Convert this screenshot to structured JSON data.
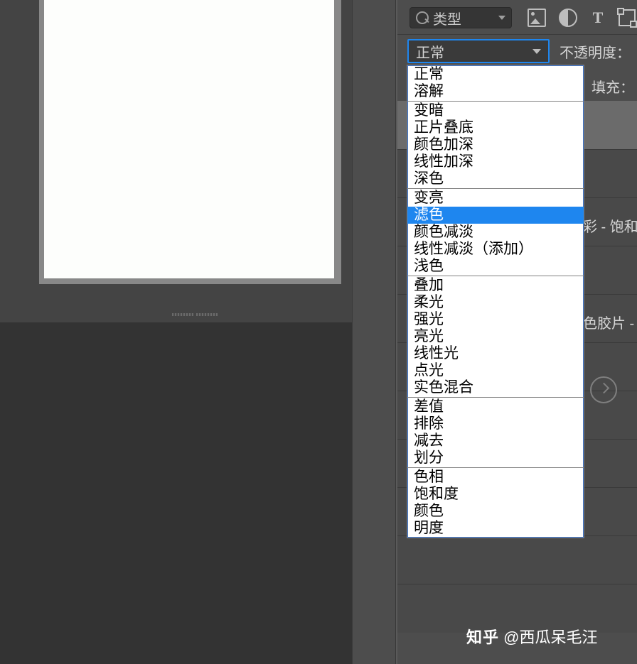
{
  "filter": {
    "kind_label": "类型",
    "icons": [
      "image-filter-icon",
      "adjustment-filter-icon",
      "text-filter-icon",
      "shape-filter-icon"
    ]
  },
  "blend_mode": {
    "selected": "正常",
    "highlighted": "滤色",
    "groups": [
      [
        "正常",
        "溶解"
      ],
      [
        "变暗",
        "正片叠底",
        "颜色加深",
        "线性加深",
        "深色"
      ],
      [
        "变亮",
        "滤色",
        "颜色减淡",
        "线性减淡（添加）",
        "浅色"
      ],
      [
        "叠加",
        "柔光",
        "强光",
        "亮光",
        "线性光",
        "点光",
        "实色混合"
      ],
      [
        "差值",
        "排除",
        "减去",
        "划分"
      ],
      [
        "色相",
        "饱和度",
        "颜色",
        "明度"
      ]
    ]
  },
  "labels": {
    "opacity": "不透明度：",
    "fill": "填充："
  },
  "layer_peek": {
    "row1": "彩 - 饱和",
    "row2": "色胶片 -"
  },
  "watermark": {
    "site": "知乎",
    "at": "@西瓜呆毛汪"
  }
}
